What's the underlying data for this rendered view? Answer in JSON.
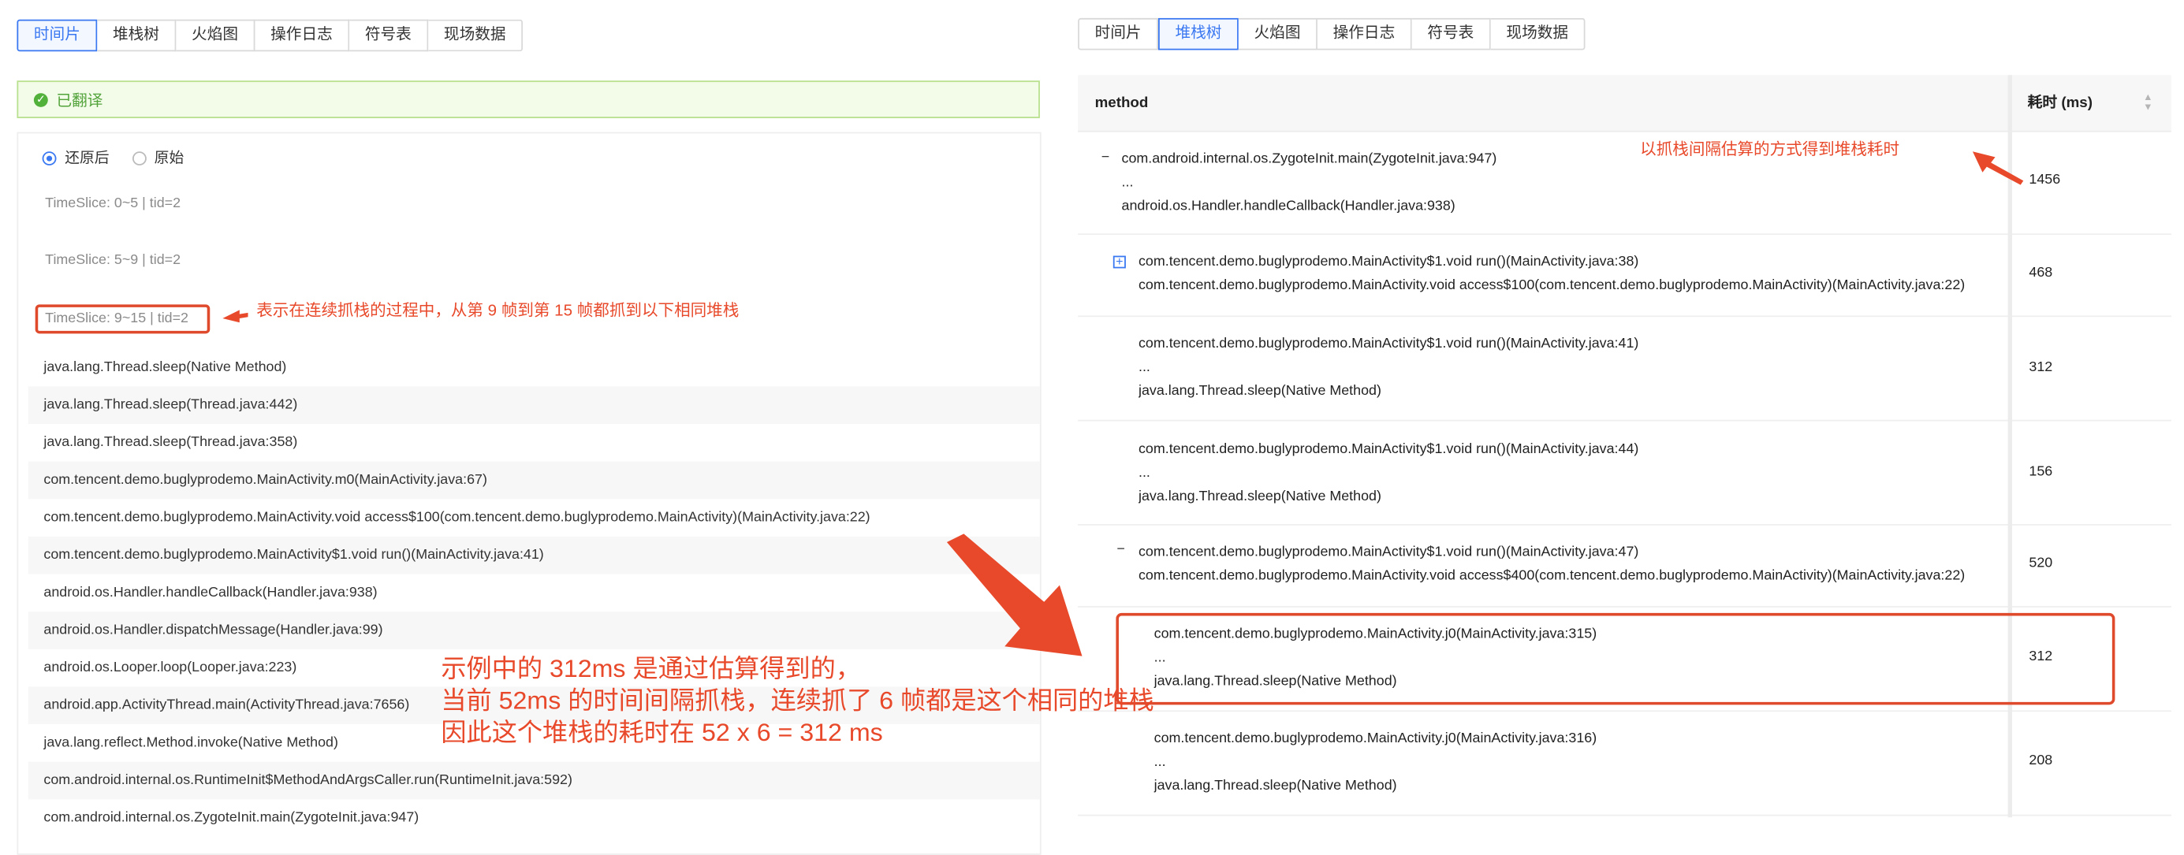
{
  "tabs": [
    "时间片",
    "堆栈树",
    "火焰图",
    "操作日志",
    "符号表",
    "现场数据"
  ],
  "left": {
    "active_tab": "时间片",
    "banner": "已翻译",
    "radio_options": [
      "还原后",
      "原始"
    ],
    "selected_radio": "还原后",
    "time_slices": [
      "TimeSlice: 0~5 | tid=2",
      "TimeSlice: 5~9 | tid=2",
      "TimeSlice: 9~15 | tid=2"
    ],
    "frames": [
      "java.lang.Thread.sleep(Native Method)",
      "java.lang.Thread.sleep(Thread.java:442)",
      "java.lang.Thread.sleep(Thread.java:358)",
      "com.tencent.demo.buglyprodemo.MainActivity.m0(MainActivity.java:67)",
      "com.tencent.demo.buglyprodemo.MainActivity.void access$100(com.tencent.demo.buglyprodemo.MainActivity)(MainActivity.java:22)",
      "com.tencent.demo.buglyprodemo.MainActivity$1.void run()(MainActivity.java:41)",
      "android.os.Handler.handleCallback(Handler.java:938)",
      "android.os.Handler.dispatchMessage(Handler.java:99)",
      "android.os.Looper.loop(Looper.java:223)",
      "android.app.ActivityThread.main(ActivityThread.java:7656)",
      "java.lang.reflect.Method.invoke(Native Method)",
      "com.android.internal.os.RuntimeInit$MethodAndArgsCaller.run(RuntimeInit.java:592)",
      "com.android.internal.os.ZygoteInit.main(ZygoteInit.java:947)"
    ]
  },
  "right": {
    "active_tab": "堆栈树",
    "col_method": "method",
    "col_time": "耗时 (ms)",
    "rows": [
      {
        "lines": [
          "com.android.internal.os.ZygoteInit.main(ZygoteInit.java:947)",
          "...",
          "android.os.Handler.handleCallback(Handler.java:938)"
        ],
        "time": "1456"
      },
      {
        "lines": [
          "com.tencent.demo.buglyprodemo.MainActivity$1.void run()(MainActivity.java:38)",
          "com.tencent.demo.buglyprodemo.MainActivity.void access$100(com.tencent.demo.buglyprodemo.MainActivity)(MainActivity.java:22)"
        ],
        "time": "468"
      },
      {
        "lines": [
          "com.tencent.demo.buglyprodemo.MainActivity$1.void run()(MainActivity.java:41)",
          "...",
          "java.lang.Thread.sleep(Native Method)"
        ],
        "time": "312"
      },
      {
        "lines": [
          "com.tencent.demo.buglyprodemo.MainActivity$1.void run()(MainActivity.java:44)",
          "...",
          "java.lang.Thread.sleep(Native Method)"
        ],
        "time": "156"
      },
      {
        "lines": [
          "com.tencent.demo.buglyprodemo.MainActivity$1.void run()(MainActivity.java:47)",
          "com.tencent.demo.buglyprodemo.MainActivity.void access$400(com.tencent.demo.buglyprodemo.MainActivity)(MainActivity.java:22)"
        ],
        "time": "520"
      },
      {
        "lines": [
          "com.tencent.demo.buglyprodemo.MainActivity.j0(MainActivity.java:315)",
          "...",
          "java.lang.Thread.sleep(Native Method)"
        ],
        "time": "312"
      },
      {
        "lines": [
          "com.tencent.demo.buglyprodemo.MainActivity.j0(MainActivity.java:316)",
          "...",
          "java.lang.Thread.sleep(Native Method)"
        ],
        "time": "208"
      }
    ]
  },
  "annotations": {
    "timeslice_note": "表示在连续抓栈的过程中，从第 9 帧到第 15 帧都抓到以下相同堆栈",
    "time_note": "以抓栈间隔估算的方式得到堆栈耗时",
    "big_note": [
      "示例中的 312ms 是通过估算得到的，",
      "当前 52ms 的时间间隔抓栈，连续抓了 6 帧都是这个相同的堆栈",
      "因此这个堆栈的耗时在 52 x 6 = 312 ms"
    ],
    "accent_color": "#e8492a",
    "link_color": "#3a78f2"
  }
}
